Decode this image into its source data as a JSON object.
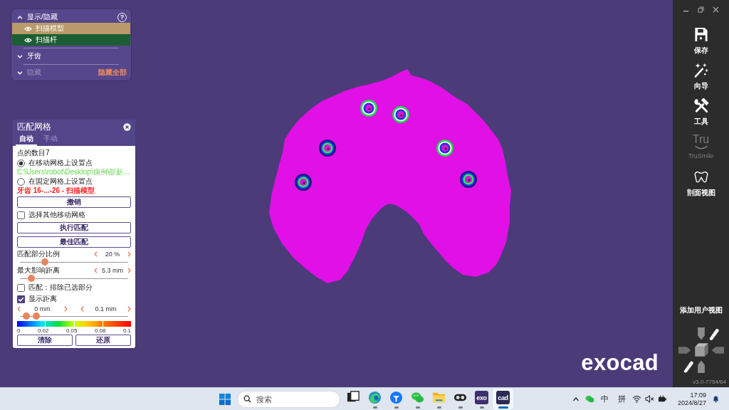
{
  "visibility_panel": {
    "help": "?",
    "sections": [
      {
        "title": "显示/隐藏",
        "expanded": true,
        "disabled": false,
        "items": [
          {
            "label": "扫描模型",
            "color": "#b99a6a",
            "visible": true
          },
          {
            "label": "扫描杆",
            "color": "#1c5e33",
            "visible": true
          }
        ]
      },
      {
        "title": "牙齿",
        "expanded": false,
        "disabled": false
      },
      {
        "title": "隐藏",
        "expanded": false,
        "disabled": true,
        "action": "隐藏全部"
      }
    ]
  },
  "match_panel": {
    "title": "匹配网格",
    "tabs": [
      {
        "label": "自动",
        "selected": true
      },
      {
        "label": "手动",
        "selected": false
      }
    ],
    "controls": [
      {
        "kind": "text",
        "text": "点的数目7"
      },
      {
        "kind": "radio",
        "label": "在移动网格上设置点",
        "selected": true
      },
      {
        "kind": "note",
        "text": "C:\\Users\\robot\\Desktop\\病例\\邵新...",
        "color": "#5fd94a"
      },
      {
        "kind": "radio",
        "label": "在固定网格上设置点",
        "selected": false
      },
      {
        "kind": "warning",
        "text": "牙齿 16-...-26 - 扫描模型",
        "color": "#ff2020"
      },
      {
        "kind": "button",
        "label": "撤销"
      },
      {
        "kind": "checkbox",
        "label": "选择其他移动网格",
        "checked": false
      },
      {
        "kind": "button",
        "label": "执行匹配"
      },
      {
        "kind": "button",
        "label": "最佳匹配"
      },
      {
        "kind": "slider",
        "label": "匹配部分比例",
        "reading": "20 %",
        "level": 0.21
      },
      {
        "kind": "slider",
        "label": "最大影响距离",
        "reading": "5.3 mm",
        "level": 0.08
      },
      {
        "kind": "checkbox",
        "label": "匹配：排除已选部分",
        "checked": false
      },
      {
        "kind": "checkbox",
        "label": "显示距离",
        "checked": true
      },
      {
        "kind": "range",
        "low": {
          "reading": "0 mm",
          "level": 0.03
        },
        "high": {
          "reading": "0.1 mm",
          "level": 0.13
        }
      },
      {
        "kind": "scale",
        "ticks": [
          "0",
          "0.02",
          "0.05",
          "0.08",
          "0.1"
        ]
      },
      {
        "kind": "buttons",
        "buttons": [
          "清除",
          "还原"
        ]
      }
    ]
  },
  "logo": "exocad",
  "toolbar": {
    "items": [
      {
        "kind": "save",
        "label": "保存",
        "disabled": false
      },
      {
        "kind": "wand",
        "label": "向导",
        "disabled": false
      },
      {
        "kind": "tools",
        "label": "工具",
        "disabled": false
      },
      {
        "kind": "trusmile",
        "logo": "Tru",
        "label": "TruSmile",
        "disabled": true
      },
      {
        "kind": "section",
        "label": "剖面视图",
        "disabled": false
      }
    ],
    "user_view": "添加用户视图",
    "version": "v3.0-7754/64"
  },
  "taskbar": {
    "search": {
      "placeholder": "搜索"
    },
    "apps": [
      {
        "kind": "task-view",
        "running": false,
        "selected": false
      },
      {
        "kind": "swirl",
        "running": true,
        "selected": false
      },
      {
        "kind": "pin",
        "running": true,
        "selected": false
      },
      {
        "kind": "chat",
        "running": true,
        "selected": false
      },
      {
        "kind": "folder",
        "running": true,
        "selected": false
      },
      {
        "kind": "goggles",
        "running": true,
        "selected": false
      },
      {
        "kind": "tile",
        "label": "exo",
        "running": true,
        "selected": false
      },
      {
        "kind": "tile",
        "label": "cad",
        "running": true,
        "selected": true
      }
    ],
    "tray": {
      "input_modes": [
        "中",
        "拼"
      ],
      "time": "17:09",
      "date": "2024/8/27"
    }
  }
}
